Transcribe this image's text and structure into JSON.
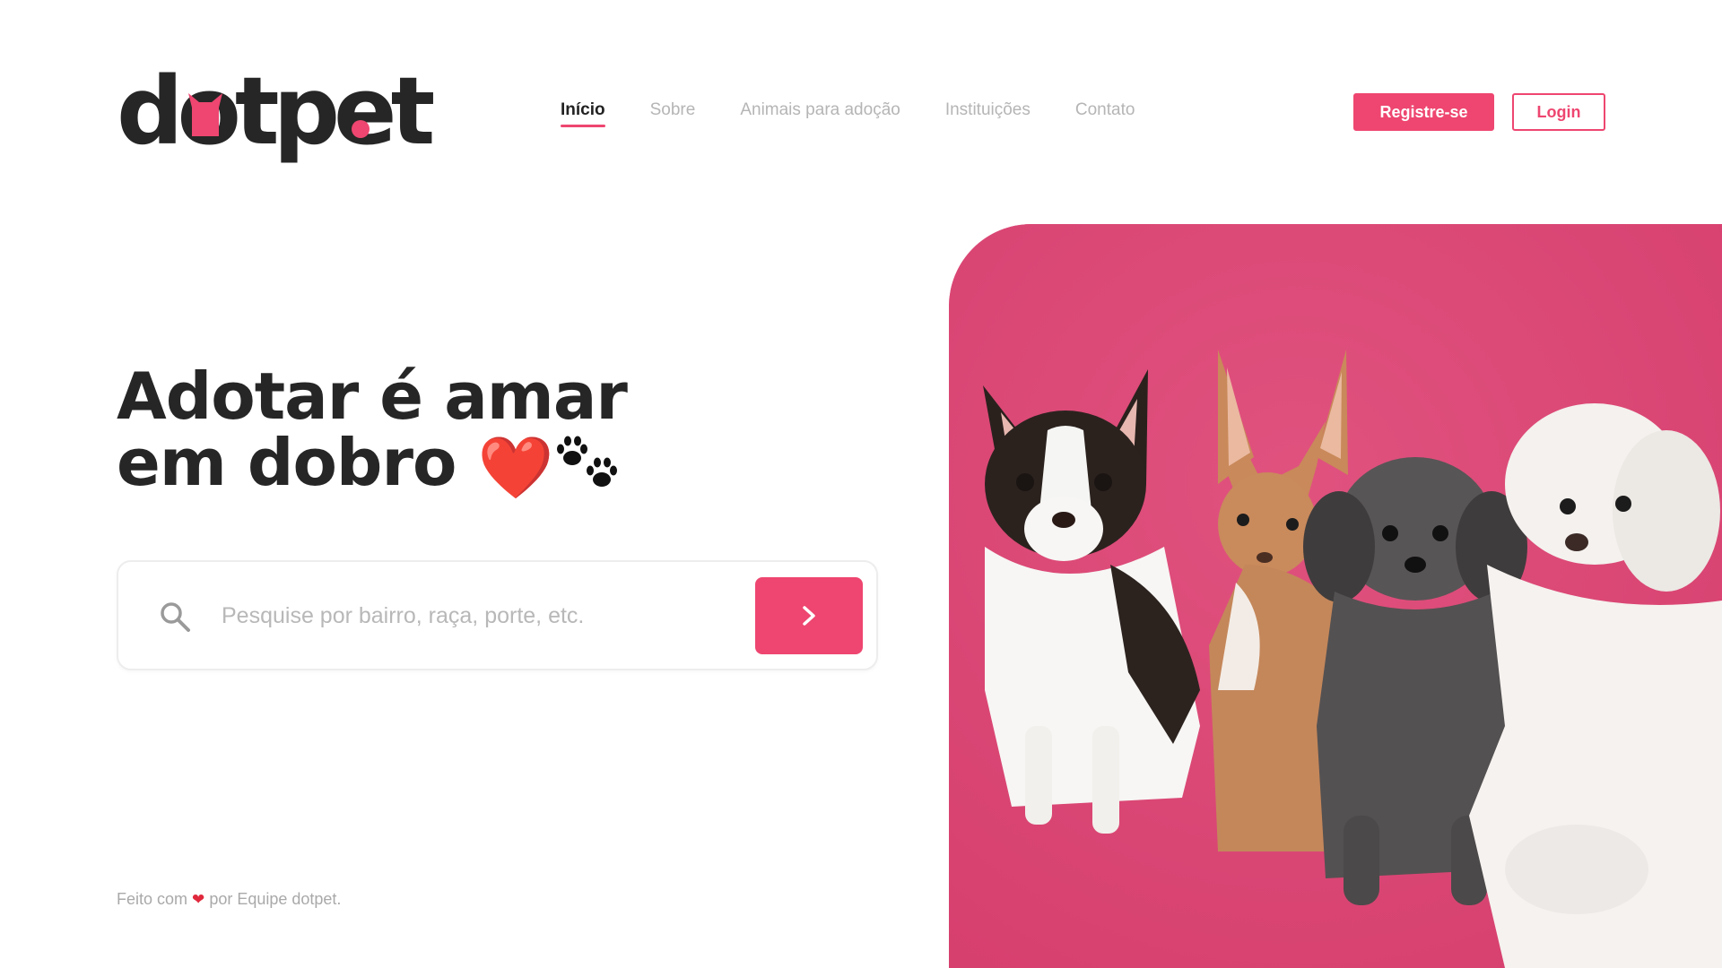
{
  "brand": {
    "logo_text": "dotpet",
    "accent_color": "#ee4670",
    "text_color": "#262626"
  },
  "nav": {
    "items": [
      {
        "label": "Início",
        "active": true
      },
      {
        "label": "Sobre",
        "active": false
      },
      {
        "label": "Animais para adoção",
        "active": false
      },
      {
        "label": "Instituições",
        "active": false
      },
      {
        "label": "Contato",
        "active": false
      }
    ]
  },
  "auth": {
    "register_label": "Registre-se",
    "login_label": "Login"
  },
  "hero": {
    "title_line1": "Adotar é amar",
    "title_line2": "em dobro",
    "heart_emoji": "❤️",
    "paw_icon": "paw-prints-icon"
  },
  "search": {
    "placeholder": "Pesquise por bairro, raça, porte, etc.",
    "value": "",
    "icon": "search-icon",
    "submit_icon": "chevron-right-icon"
  },
  "footer": {
    "prefix": "Feito com",
    "heart": "❤",
    "suffix": "por Equipe dotpet."
  },
  "photo": {
    "background_color": "#dc4a78",
    "subject": "four-dogs-photo"
  }
}
